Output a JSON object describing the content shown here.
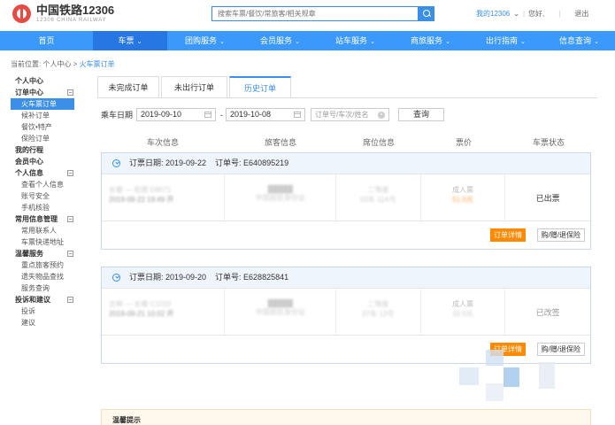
{
  "header": {
    "logo_title": "中国铁路12306",
    "logo_sub": "12306 CHINA RAILWAY",
    "search_placeholder": "搜索车票/餐饮/常旅客/相关规章",
    "my_account": "我的12306",
    "greeting": "您好,",
    "logout": "退出"
  },
  "nav": {
    "items": [
      {
        "label": "首页",
        "chev": ""
      },
      {
        "label": "车票",
        "chev": "⌄"
      },
      {
        "label": "团购服务",
        "chev": "⌄"
      },
      {
        "label": "会员服务",
        "chev": "⌄"
      },
      {
        "label": "站车服务",
        "chev": "⌄"
      },
      {
        "label": "商旅服务",
        "chev": "⌄"
      },
      {
        "label": "出行指南",
        "chev": "⌄"
      },
      {
        "label": "信息查询",
        "chev": "⌄"
      }
    ]
  },
  "breadcrumb": {
    "prefix": "当前位置: 个人中心 > ",
    "current": "火车票订单"
  },
  "sidebar": {
    "personal_center": "个人中心",
    "order_center": "订单中心",
    "train_orders": "火车票订单",
    "waitlist_orders": "候补订单",
    "food_orders": "餐饮•特产",
    "insurance_orders": "保险订单",
    "my_trips": "我的行程",
    "member_center": "会员中心",
    "personal_info": "个人信息",
    "view_info": "查看个人信息",
    "account_security": "账号安全",
    "phone_verify": "手机核验",
    "common_info": "常用信息管理",
    "contacts": "常用联系人",
    "delivery": "车票快递地址",
    "warm_service": "温馨服务",
    "priority_booking": "重点旅客预约",
    "lost_found": "遗失物品查找",
    "service_query": "服务查询",
    "complaints": "投诉和建议",
    "complaint": "投诉",
    "suggestion": "建议"
  },
  "tabs": {
    "unfinished": "未完成订单",
    "untraveled": "未出行订单",
    "history": "历史订单"
  },
  "filter": {
    "label": "乘车日期",
    "start_date": "2019-09-10",
    "dash": "-",
    "end_date": "2019-10-08",
    "order_placeholder": "订单号/车次/姓名",
    "query": "查询"
  },
  "table": {
    "headers": [
      "车次信息",
      "旅客信息",
      "席位信息",
      "票价",
      "车票状态"
    ]
  },
  "orders": [
    {
      "date_label": "订票日期: 2019-09-22",
      "order_no": "订单号: E640895219",
      "train_line1": "长春 — 松原 D8071",
      "train_line2": "2019-09-22  19:49 开",
      "passenger_line1": "█████",
      "passenger_line2": "中国居民身份证",
      "seat_line1": "二等座",
      "seat_line2": "03车 11A号",
      "price_line1": "成人票",
      "price_line2": "51.5元",
      "status": "已出票",
      "detail_btn": "订单详情",
      "insurance_btn": "购/赠/退保险"
    },
    {
      "date_label": "订票日期: 2019-09-20",
      "order_no": "订单号: E628825841",
      "train_line1": "吉林 — 长春 C1033",
      "train_line2": "2019-09-21  10:02 开",
      "passenger_line1": "█████",
      "passenger_line2": "中国居民身份证",
      "seat_line1": "二等座",
      "seat_line2": "07车 13号",
      "price_line1": "成人票",
      "price_line2": "33.5元",
      "status": "已改签",
      "detail_btn": "订单详情",
      "insurance_btn": "购/赠/退保险"
    }
  ],
  "notice": {
    "title": "温馨提示"
  }
}
